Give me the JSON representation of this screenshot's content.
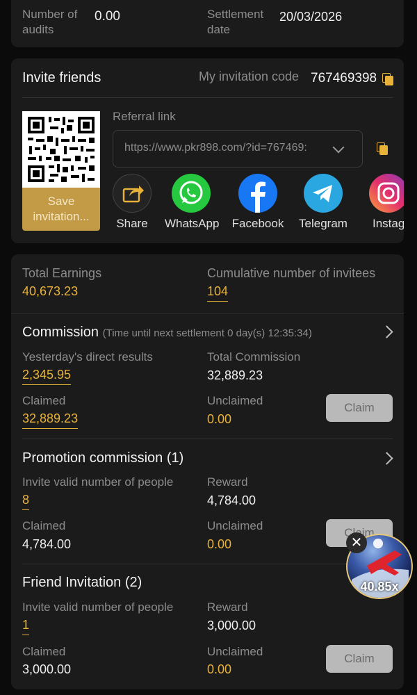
{
  "top": {
    "audits_label": "Number of audits",
    "audits_value": "0.00",
    "settlement_label": "Settlement date",
    "settlement_value": "20/03/2026"
  },
  "invite": {
    "title": "Invite friends",
    "code_label": "My invitation code",
    "code_value": "767469398",
    "save_label": "Save invitation...",
    "referral_label": "Referral link",
    "referral_value": "https://www.pkr898.com/?id=767469:",
    "share": [
      {
        "label": "Share",
        "icon": "share-icon"
      },
      {
        "label": "WhatsApp",
        "icon": "whatsapp-icon"
      },
      {
        "label": "Facebook",
        "icon": "facebook-icon"
      },
      {
        "label": "Telegram",
        "icon": "telegram-icon"
      },
      {
        "label": "Instag",
        "icon": "instagram-icon"
      }
    ]
  },
  "earnings": {
    "total_label": "Total Earnings",
    "total_value": "40,673.23",
    "invitees_label": "Cumulative number of invitees",
    "invitees_value": "104"
  },
  "commission": {
    "title": "Commission",
    "note": "(Time until next settlement  0 day(s) 12:35:34)",
    "yesterday_label": "Yesterday's direct results",
    "yesterday_value": "2,345.95",
    "total_label": "Total Commission",
    "total_value": "32,889.23",
    "claimed_label": "Claimed",
    "claimed_value": "32,889.23",
    "unclaimed_label": "Unclaimed",
    "unclaimed_value": "0.00",
    "claim_button": "Claim"
  },
  "promotion": {
    "title": "Promotion commission (1)",
    "invite_label": "Invite valid number of people",
    "invite_value": "8",
    "reward_label": "Reward",
    "reward_value": "4,784.00",
    "claimed_label": "Claimed",
    "claimed_value": "4,784.00",
    "unclaimed_label": "Unclaimed",
    "unclaimed_value": "0.00",
    "claim_button": "Claim"
  },
  "friend": {
    "title": "Friend Invitation (2)",
    "invite_label": "Invite valid number of people",
    "invite_value": "1",
    "reward_label": "Reward",
    "reward_value": "3,000.00",
    "claimed_label": "Claimed",
    "claimed_value": "3,000.00",
    "unclaimed_label": "Unclaimed",
    "unclaimed_value": "0.00",
    "claim_button": "Claim"
  },
  "floating_game": {
    "multiplier": "40.85x"
  },
  "colors": {
    "accent": "#e8b23a",
    "card": "#1b1b1b",
    "background": "#0b0b0b"
  }
}
